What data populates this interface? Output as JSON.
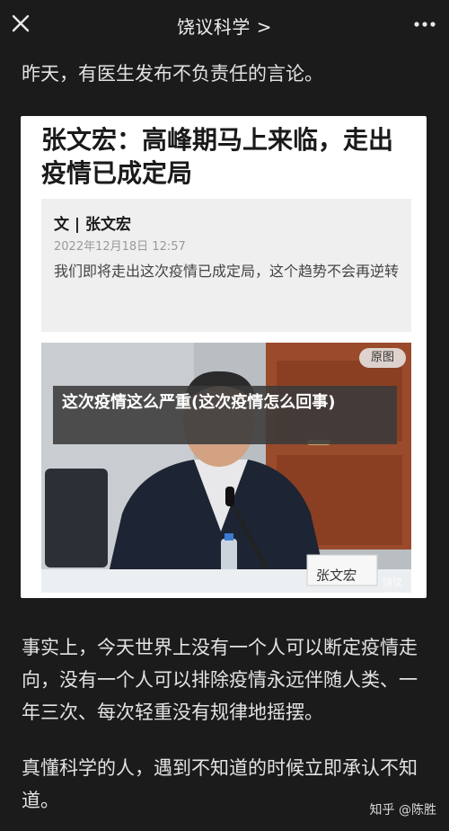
{
  "header": {
    "title": "饶议科学 >"
  },
  "paragraphs": {
    "p1": "昨天，有医生发布不负责任的言论。",
    "p2": "事实上，今天世界上没有一个人可以断定疫情走向，没有一个人可以排除疫情永远伴随人类、一年三次、每次轻重没有规律地摇摆。",
    "p3": "真懂科学的人，遇到不知道的时候立即承认不知道。"
  },
  "card": {
    "headline": "张文宏：高峰期马上来临，走出疫情已成定局",
    "quote": {
      "author": "文 | 张文宏",
      "date": "2022年12月18日 12:57",
      "body": "我们即将走出这次疫情已成定局，这个趋势不会再逆转"
    },
    "photo": {
      "badge": "原图",
      "nameplate": "张文宏",
      "watermark": "饶议科学"
    }
  },
  "overlay": {
    "title": "这次疫情这么严重(这次疫情怎么回事)"
  },
  "watermark": {
    "zhihu": "知乎 @陈胜"
  },
  "colors": {
    "page_bg": "#1b1b1b",
    "text": "#e2e2e2",
    "card_bg": "#ffffff",
    "quote_bg": "#efefef"
  }
}
